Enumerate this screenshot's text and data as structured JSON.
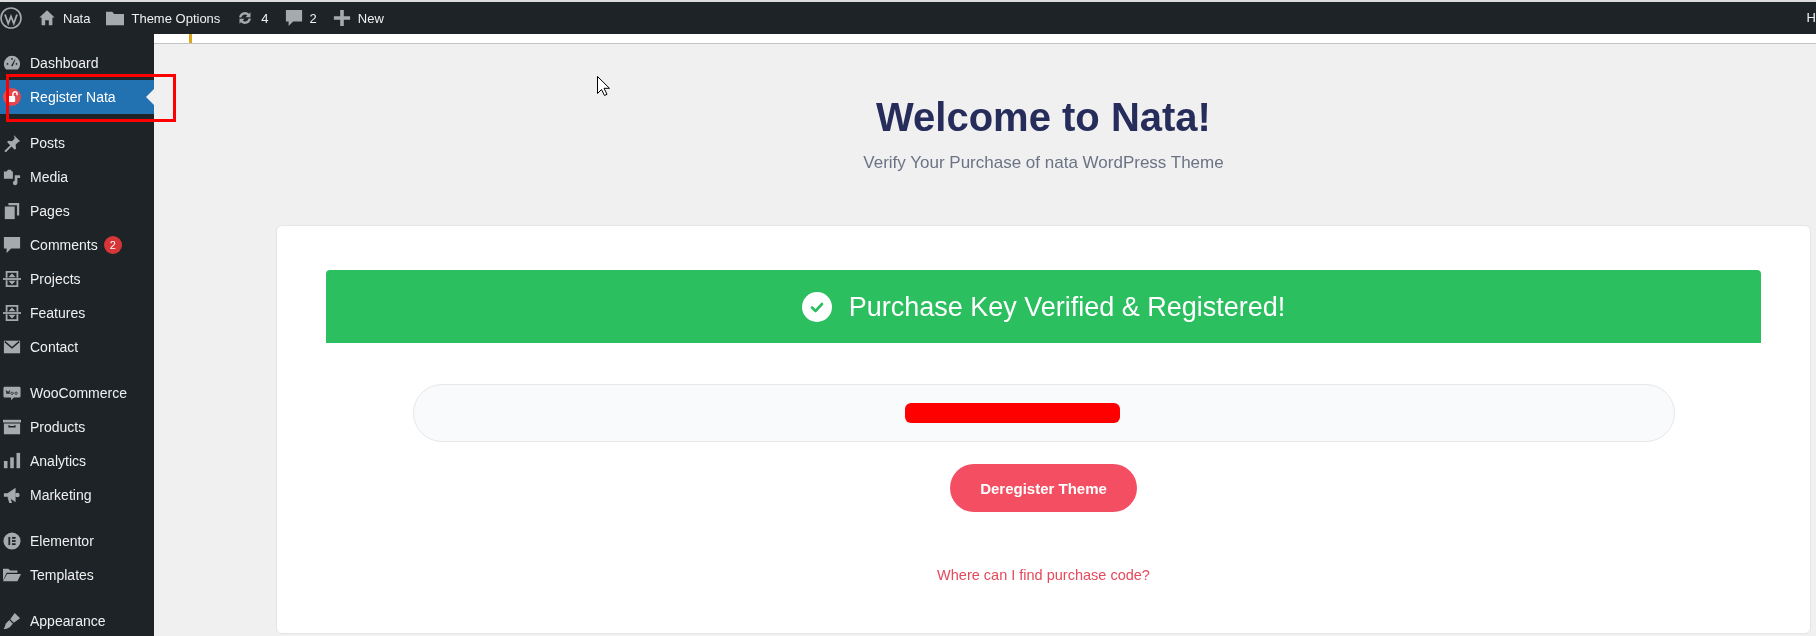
{
  "admin_bar": {
    "items": [
      {
        "label": "Nata"
      },
      {
        "label": "Theme Options"
      },
      {
        "label": "4"
      },
      {
        "label": "2"
      },
      {
        "label": "New"
      }
    ],
    "account_label": "H"
  },
  "sidebar": {
    "sections": [
      {
        "items": [
          {
            "label": "Dashboard",
            "selected": false,
            "annotated": false
          },
          {
            "label": "Register Nata",
            "selected": true,
            "annotated": true
          }
        ]
      },
      {
        "items": [
          {
            "label": "Posts",
            "selected": false,
            "annotated": false
          },
          {
            "label": "Media",
            "selected": false,
            "annotated": false
          },
          {
            "label": "Pages",
            "selected": false,
            "annotated": false
          },
          {
            "label": "Comments",
            "badge": "2",
            "selected": false,
            "annotated": false
          },
          {
            "label": "Projects",
            "selected": false,
            "annotated": false
          },
          {
            "label": "Features",
            "selected": false,
            "annotated": false
          },
          {
            "label": "Contact",
            "selected": false,
            "annotated": false
          }
        ]
      },
      {
        "items": [
          {
            "label": "WooCommerce",
            "selected": false,
            "annotated": false
          },
          {
            "label": "Products",
            "selected": false,
            "annotated": false
          },
          {
            "label": "Analytics",
            "selected": false,
            "annotated": false
          },
          {
            "label": "Marketing",
            "selected": false,
            "annotated": false
          }
        ]
      },
      {
        "items": [
          {
            "label": "Elementor",
            "selected": false,
            "annotated": false
          },
          {
            "label": "Templates",
            "selected": false,
            "annotated": false
          }
        ]
      },
      {
        "items": [
          {
            "label": "Appearance",
            "selected": false,
            "annotated": false
          }
        ]
      }
    ]
  },
  "header": {
    "title": "Welcome to Nata!",
    "subtitle": "Verify Your Purchase of nata WordPress Theme"
  },
  "card": {
    "banner": {
      "message": "Purchase Key Verified & Registered!"
    },
    "purchase_field": {
      "redacted": true
    },
    "button": "Deregister Theme",
    "help_link": "Where can I find purchase code?"
  }
}
